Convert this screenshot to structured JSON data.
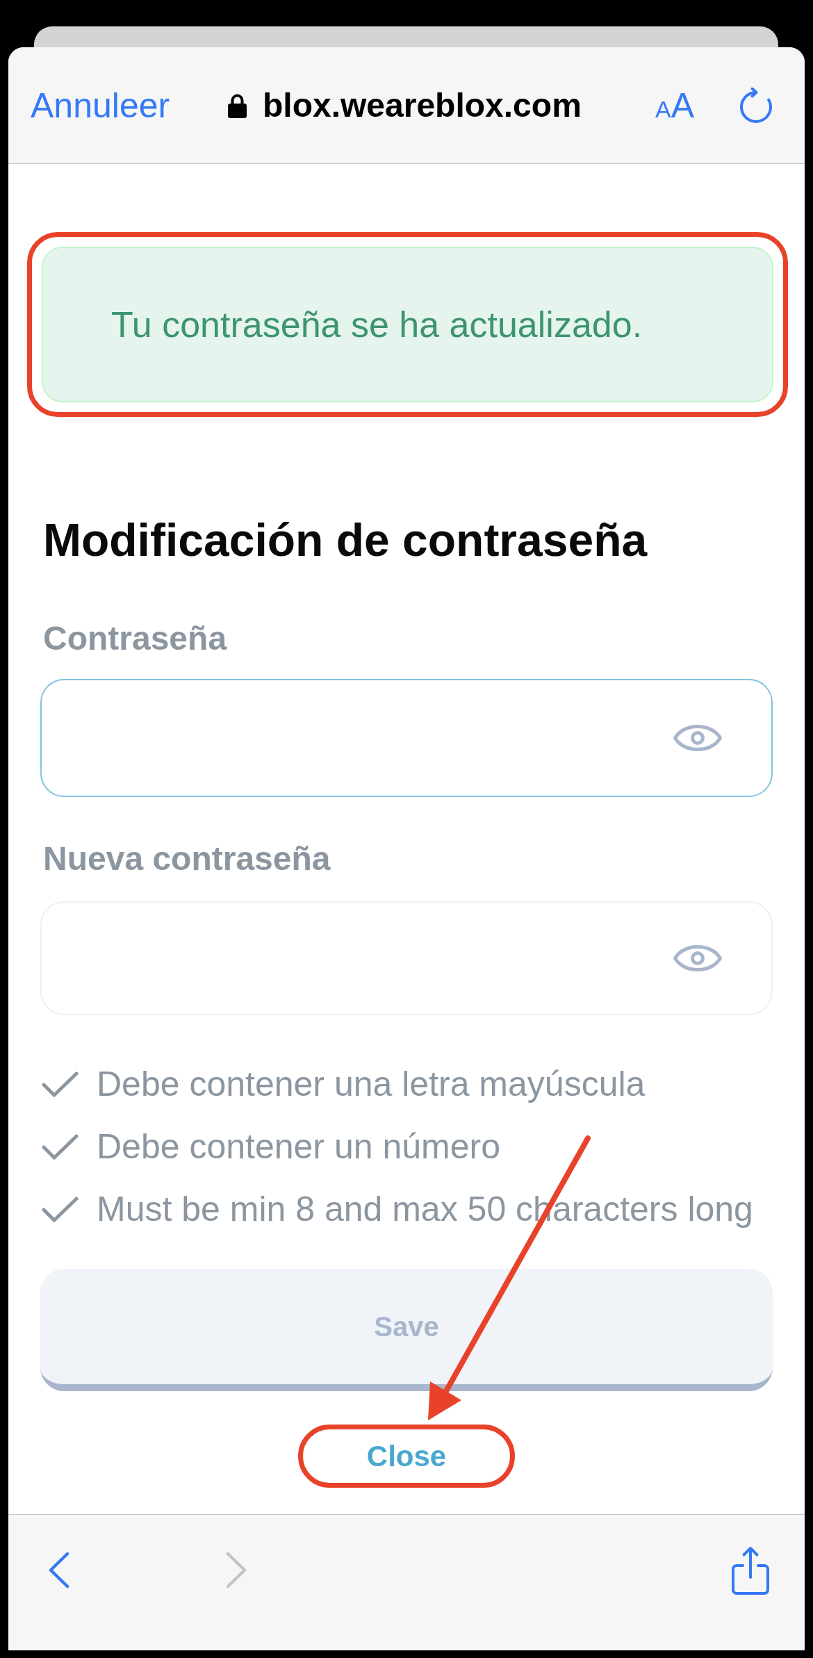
{
  "browser": {
    "cancel_link": "Annuleer",
    "secure": true,
    "url": "blox.weareblox.com",
    "text_size_button": "AA",
    "back_disabled": false,
    "forward_disabled": true
  },
  "alert": {
    "text": "Tu contraseña se ha actualizado.",
    "highlighted": true
  },
  "form": {
    "title": "Modificación de contraseña",
    "fields": [
      {
        "label": "Contraseña",
        "focused": true
      },
      {
        "label": "Nueva contraseña",
        "focused": false
      }
    ],
    "requirements": [
      "Debe contener una letra mayúscula",
      "Debe contener un número",
      "Must be min 8 and max 50 characters long"
    ],
    "save_button": {
      "label": "Save",
      "disabled": true
    },
    "close_button": {
      "label": "Close",
      "highlighted": true,
      "pointed_at": true
    }
  }
}
